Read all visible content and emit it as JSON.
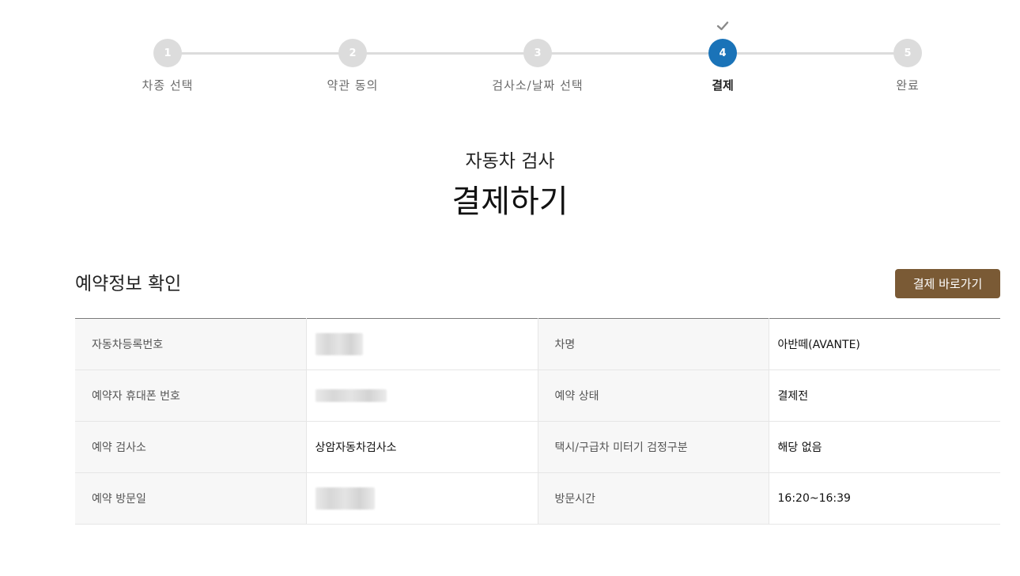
{
  "stepper": {
    "steps": [
      {
        "number": "1",
        "label": "차종 선택"
      },
      {
        "number": "2",
        "label": "약관 동의"
      },
      {
        "number": "3",
        "label": "검사소/날짜 선택"
      },
      {
        "number": "4",
        "label": "결제"
      },
      {
        "number": "5",
        "label": "완료"
      }
    ],
    "active_step": 4,
    "active_color": "#1a73b8",
    "inactive_color": "#dcdcdc"
  },
  "header": {
    "subtitle": "자동차 검사",
    "title": "결제하기"
  },
  "section": {
    "title": "예약정보 확인",
    "pay_button_label": "결제 바로가기",
    "button_color": "#7a5a35"
  },
  "table": {
    "rows": [
      [
        {
          "label": "자동차등록번호",
          "value": ""
        },
        {
          "label": "차명",
          "value": "아반떼(AVANTE)"
        }
      ],
      [
        {
          "label": "예약자 휴대폰 번호",
          "value": ""
        },
        {
          "label": "예약 상태",
          "value": "결제전"
        }
      ],
      [
        {
          "label": "예약 검사소",
          "value": "상암자동차검사소"
        },
        {
          "label": "택시/구급차 미터기 검정구분",
          "value": "해당 없음"
        }
      ],
      [
        {
          "label": "예약 방문일",
          "value": ""
        },
        {
          "label": "방문시간",
          "value": "16:20~16:39"
        }
      ]
    ],
    "status_color": "#c0392b"
  }
}
